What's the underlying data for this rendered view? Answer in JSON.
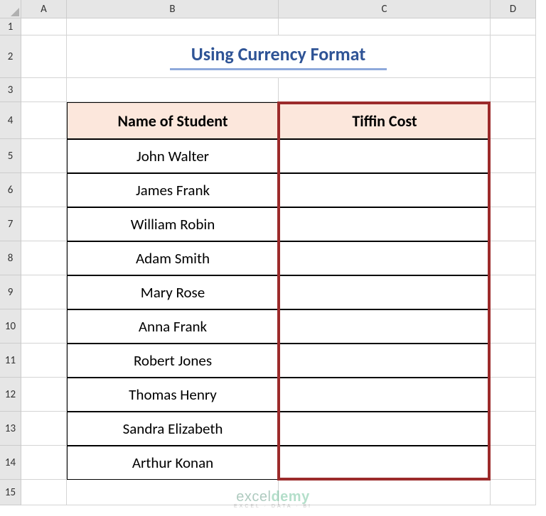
{
  "columns": [
    "A",
    "B",
    "C",
    "D"
  ],
  "rows": [
    "1",
    "2",
    "3",
    "4",
    "5",
    "6",
    "7",
    "8",
    "9",
    "10",
    "11",
    "12",
    "13",
    "14",
    "15"
  ],
  "title": "Using Currency Format",
  "table": {
    "headers": {
      "name": "Name of Student",
      "cost": "Tiffin Cost"
    },
    "students": [
      "John Walter",
      "James Frank",
      "William Robin",
      "Adam Smith",
      "Mary Rose",
      "Anna Frank",
      "Robert Jones",
      "Thomas Henry",
      "Sandra Elizabeth",
      "Arthur Konan"
    ],
    "costs": [
      "",
      "",
      "",
      "",
      "",
      "",
      "",
      "",
      "",
      ""
    ]
  },
  "chart_data": {
    "type": "table",
    "title": "Using Currency Format",
    "columns": [
      "Name of Student",
      "Tiffin Cost"
    ],
    "rows": [
      [
        "John Walter",
        ""
      ],
      [
        "James Frank",
        ""
      ],
      [
        "William Robin",
        ""
      ],
      [
        "Adam Smith",
        ""
      ],
      [
        "Mary Rose",
        ""
      ],
      [
        "Anna Frank",
        ""
      ],
      [
        "Robert Jones",
        ""
      ],
      [
        "Thomas Henry",
        ""
      ],
      [
        "Sandra Elizabeth",
        ""
      ],
      [
        "Arthur Konan",
        ""
      ]
    ]
  },
  "watermark": {
    "brand_prefix": "excel",
    "brand_suffix": "demy",
    "tagline": "EXCEL · DATA · BI"
  }
}
